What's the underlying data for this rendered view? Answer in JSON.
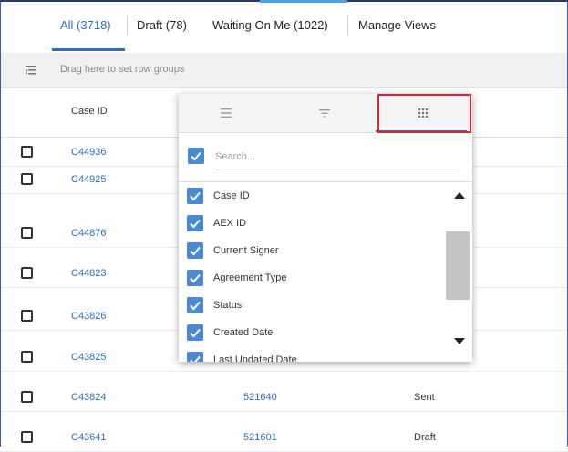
{
  "tabs": [
    {
      "label": "All (3718)",
      "active": true
    },
    {
      "label": "Draft (78)",
      "active": false
    },
    {
      "label": "Waiting On Me (1022)",
      "active": false
    },
    {
      "label": "Manage Views",
      "active": false
    }
  ],
  "group_bar": {
    "icon": "row-group-icon",
    "text": "Drag here to set row groups"
  },
  "header": {
    "case_id": "Case ID"
  },
  "rows": [
    {
      "case_id": "C44936",
      "aex_id": "",
      "status": ""
    },
    {
      "case_id": "C44925",
      "aex_id": "",
      "status": ""
    },
    {
      "case_id": "C44876",
      "aex_id": "",
      "status": ""
    },
    {
      "case_id": "C44823",
      "aex_id": "",
      "status": ""
    },
    {
      "case_id": "C43826",
      "aex_id": "",
      "status": ""
    },
    {
      "case_id": "C43825",
      "aex_id": "",
      "status": ""
    },
    {
      "case_id": "C43824",
      "aex_id": "521640",
      "status": "Sent"
    },
    {
      "case_id": "C43641",
      "aex_id": "521601",
      "status": "Draft"
    }
  ],
  "panel": {
    "tabs": [
      {
        "icon": "menu-icon"
      },
      {
        "icon": "filter-icon"
      },
      {
        "icon": "columns-grid-icon",
        "active": true
      }
    ],
    "search_placeholder": "Search...",
    "columns": [
      {
        "label": "Case ID",
        "checked": true
      },
      {
        "label": "AEX ID",
        "checked": true
      },
      {
        "label": "Current Signer",
        "checked": true
      },
      {
        "label": "Agreement Type",
        "checked": true
      },
      {
        "label": "Status",
        "checked": true
      },
      {
        "label": "Created Date",
        "checked": true
      },
      {
        "label": "Last Updated Date",
        "checked": true
      }
    ]
  },
  "colors": {
    "accent": "#2a6fc1",
    "checkbox": "#4a8ad4",
    "highlight": "#e0202a"
  }
}
